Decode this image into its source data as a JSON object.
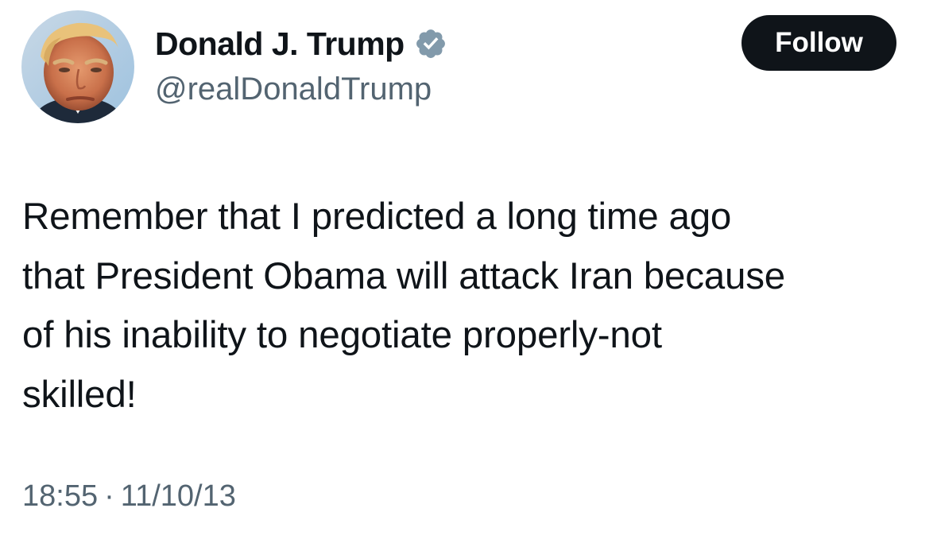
{
  "author": {
    "display_name": "Donald J. Trump",
    "handle": "@realDonaldTrump",
    "verified": true,
    "verified_icon": "verified-badge-icon",
    "verified_color": "#829aab"
  },
  "follow_button": {
    "label": "Follow",
    "bg_color": "#0f1419",
    "text_color": "#ffffff"
  },
  "tweet": {
    "lines": [
      "Remember that I predicted a long time ago",
      "that President Obama will attack Iran because",
      "of his inability to negotiate properly-not",
      "skilled!"
    ]
  },
  "meta": {
    "time": "18:55",
    "separator": "·",
    "date": "11/10/13"
  },
  "colors": {
    "text_primary": "#0f1419",
    "text_secondary": "#536471",
    "background": "#ffffff"
  }
}
